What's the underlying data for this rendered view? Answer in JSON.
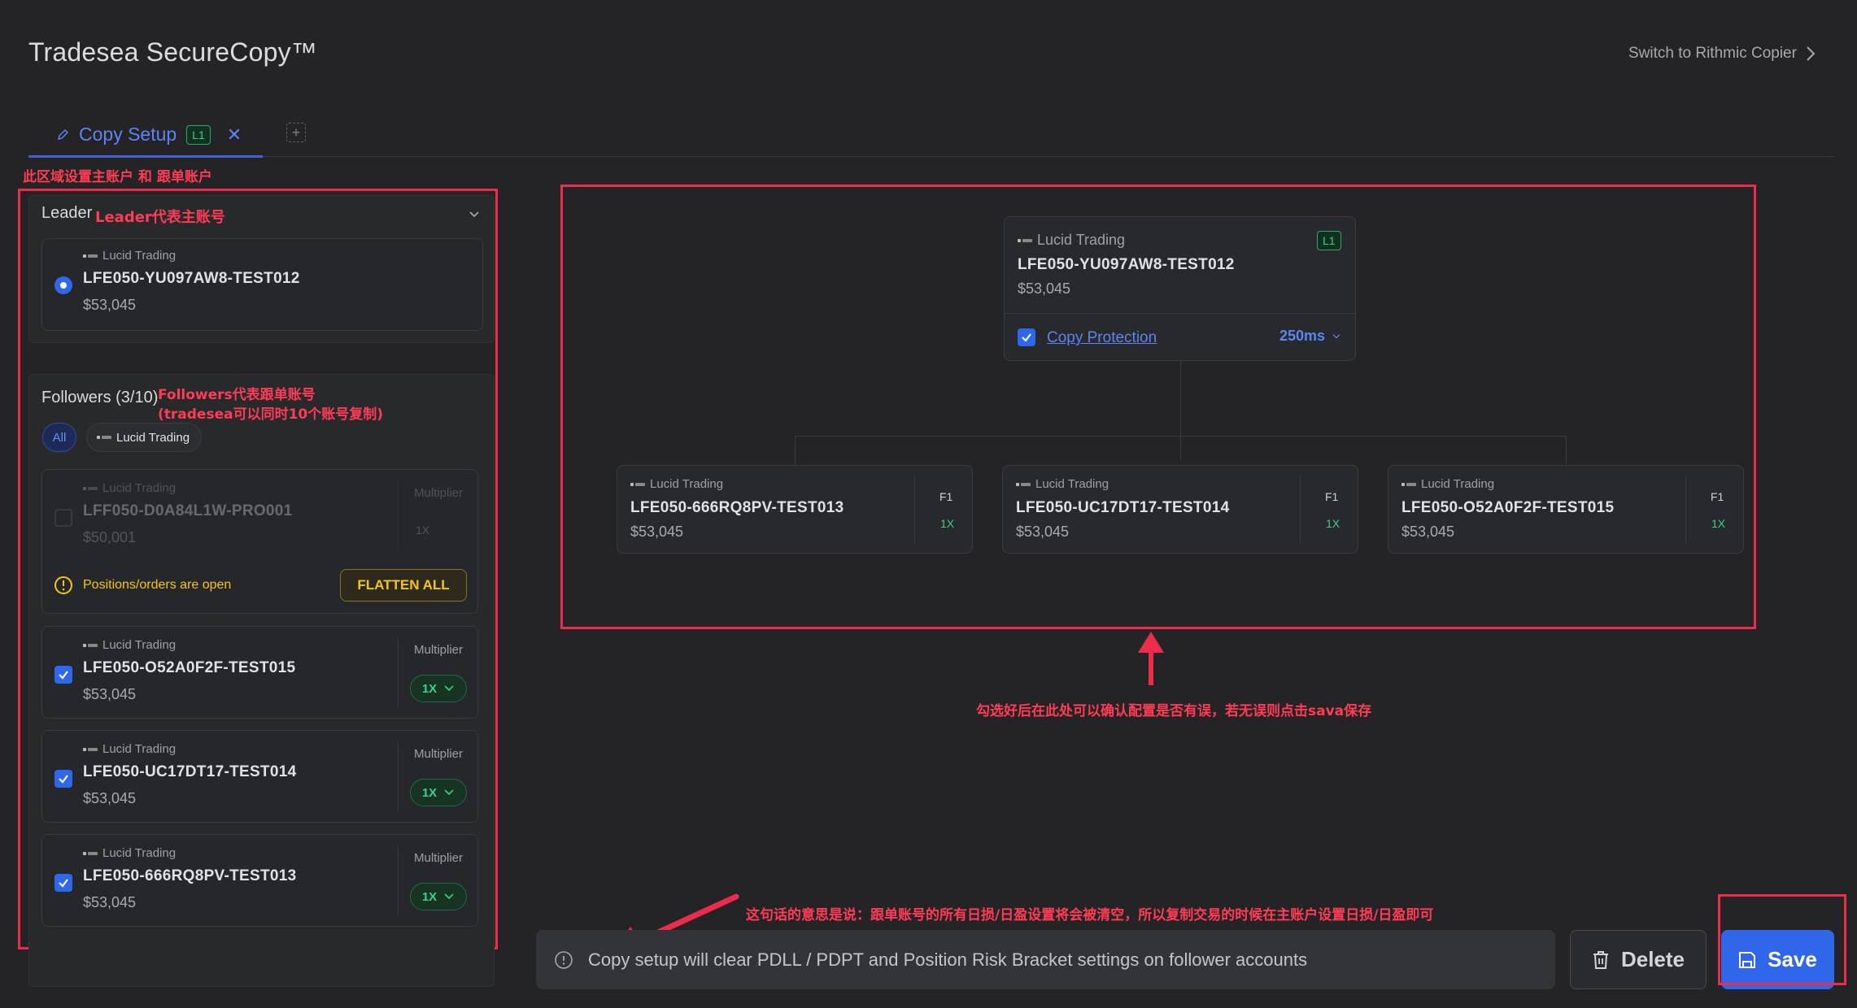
{
  "header": {
    "app_title": "Tradesea SecureCopy™",
    "switch_link": "Switch to Rithmic Copier"
  },
  "tabs": [
    {
      "label": "Copy Setup",
      "badge": "L1"
    }
  ],
  "annotations": {
    "left_area": "此区域设置主账户 和 跟单账户",
    "leader_note": "Leader代表主账号",
    "followers_note_1": "Followers代表跟单账号",
    "followers_note_2": "(tradesea可以同时10个账号复制)",
    "confirm_note": "勾选好后在此处可以确认配置是否有误，若无误则点击sava保存",
    "notice_note": "这句话的意思是说：跟单账号的所有日损/日盈设置将会被清空，所以复制交易的时候在主账户设置日损/日盈即可"
  },
  "leader": {
    "section_label": "Leader",
    "broker": "Lucid Trading",
    "account": "LFE050-YU097AW8-TEST012",
    "balance": "$53,045"
  },
  "followers": {
    "section_label": "Followers (3/10)",
    "filter_all": "All",
    "filter_broker": "Lucid Trading",
    "multiplier_label": "Multiplier",
    "items": [
      {
        "broker": "Lucid Trading",
        "account": "LFF050-D0A84L1W-PRO001",
        "balance": "$50,001",
        "multiplier": "1X",
        "checked": false,
        "warning": "Positions/orders are open",
        "action": "FLATTEN ALL"
      },
      {
        "broker": "Lucid Trading",
        "account": "LFE050-O52A0F2F-TEST015",
        "balance": "$53,045",
        "multiplier": "1X",
        "checked": true
      },
      {
        "broker": "Lucid Trading",
        "account": "LFE050-UC17DT17-TEST014",
        "balance": "$53,045",
        "multiplier": "1X",
        "checked": true
      },
      {
        "broker": "Lucid Trading",
        "account": "LFE050-666RQ8PV-TEST013",
        "balance": "$53,045",
        "multiplier": "1X",
        "checked": true
      }
    ]
  },
  "diagram": {
    "leader": {
      "broker": "Lucid Trading",
      "account": "LFE050-YU097AW8-TEST012",
      "balance": "$53,045",
      "badge": "L1",
      "copy_protection": "Copy Protection",
      "latency": "250ms"
    },
    "followers": [
      {
        "broker": "Lucid Trading",
        "account": "LFE050-666RQ8PV-TEST013",
        "balance": "$53,045",
        "badge": "F1",
        "multiplier": "1X"
      },
      {
        "broker": "Lucid Trading",
        "account": "LFE050-UC17DT17-TEST014",
        "balance": "$53,045",
        "badge": "F1",
        "multiplier": "1X"
      },
      {
        "broker": "Lucid Trading",
        "account": "LFE050-O52A0F2F-TEST015",
        "balance": "$53,045",
        "badge": "F1",
        "multiplier": "1X"
      }
    ]
  },
  "footer": {
    "notice": "Copy setup will clear PDLL / PDPT and Position Risk Bracket settings on follower accounts",
    "delete_label": "Delete",
    "save_label": "Save"
  },
  "colors": {
    "accent": "#2f66ea",
    "success": "#3dd08a",
    "warning": "#f5c518",
    "annotation": "#ec2c4a"
  }
}
